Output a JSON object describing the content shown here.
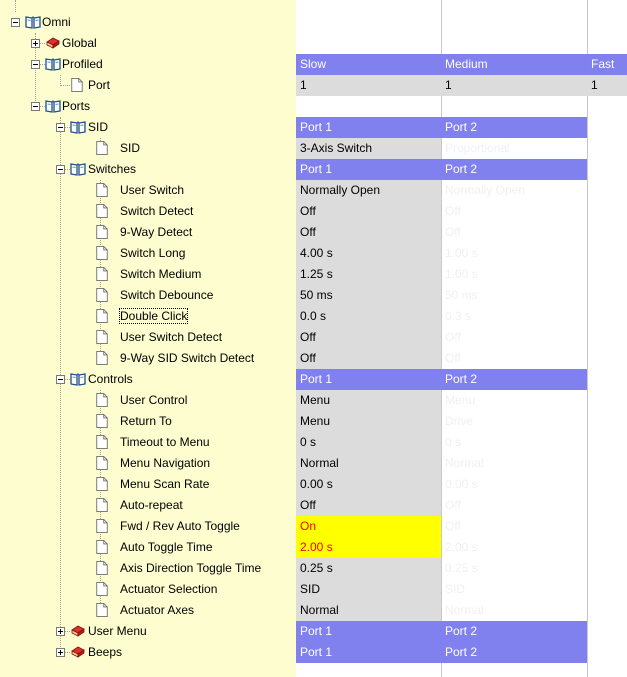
{
  "tree": [
    {
      "label": "Omni",
      "depth": 0,
      "icon": "open-book",
      "toggle": "minus"
    },
    {
      "label": "Global",
      "depth": 1,
      "icon": "closed-book",
      "toggle": "plus"
    },
    {
      "label": "Profiled",
      "depth": 1,
      "icon": "open-book",
      "toggle": "minus"
    },
    {
      "label": "Port",
      "depth": 2,
      "icon": "page"
    },
    {
      "label": "Ports",
      "depth": 1,
      "icon": "open-book",
      "toggle": "minus"
    },
    {
      "label": "SID",
      "depth": 2,
      "icon": "open-book",
      "toggle": "minus"
    },
    {
      "label": "SID",
      "depth": 3,
      "icon": "page"
    },
    {
      "label": "Switches",
      "depth": 2,
      "icon": "open-book",
      "toggle": "minus"
    },
    {
      "label": "User Switch",
      "depth": 3,
      "icon": "page"
    },
    {
      "label": "Switch Detect",
      "depth": 3,
      "icon": "page"
    },
    {
      "label": "9-Way Detect",
      "depth": 3,
      "icon": "page"
    },
    {
      "label": "Switch Long",
      "depth": 3,
      "icon": "page"
    },
    {
      "label": "Switch Medium",
      "depth": 3,
      "icon": "page"
    },
    {
      "label": "Switch Debounce",
      "depth": 3,
      "icon": "page"
    },
    {
      "label": "Double Click",
      "depth": 3,
      "icon": "page",
      "focus": true
    },
    {
      "label": "User Switch Detect",
      "depth": 3,
      "icon": "page"
    },
    {
      "label": "9-Way SID Switch Detect",
      "depth": 3,
      "icon": "page"
    },
    {
      "label": "Controls",
      "depth": 2,
      "icon": "open-book",
      "toggle": "minus"
    },
    {
      "label": "User Control",
      "depth": 3,
      "icon": "page"
    },
    {
      "label": "Return To",
      "depth": 3,
      "icon": "page"
    },
    {
      "label": "Timeout to Menu",
      "depth": 3,
      "icon": "page"
    },
    {
      "label": "Menu Navigation",
      "depth": 3,
      "icon": "page"
    },
    {
      "label": "Menu Scan Rate",
      "depth": 3,
      "icon": "page"
    },
    {
      "label": "Auto-repeat",
      "depth": 3,
      "icon": "page"
    },
    {
      "label": "Fwd / Rev Auto Toggle",
      "depth": 3,
      "icon": "page"
    },
    {
      "label": "Auto Toggle Time",
      "depth": 3,
      "icon": "page"
    },
    {
      "label": "Axis Direction Toggle Time",
      "depth": 3,
      "icon": "page"
    },
    {
      "label": "Actuator Selection",
      "depth": 3,
      "icon": "page"
    },
    {
      "label": "Actuator Axes",
      "depth": 3,
      "icon": "page"
    },
    {
      "label": "User Menu",
      "depth": 2,
      "icon": "closed-book",
      "toggle": "plus"
    },
    {
      "label": "Beeps",
      "depth": 2,
      "icon": "closed-book",
      "toggle": "plus"
    }
  ],
  "grid": [
    [],
    [],
    [
      {
        "v": "Slow",
        "s": "hdr"
      },
      {
        "v": "Medium",
        "s": "hdr"
      },
      {
        "v": "Fast",
        "s": "hdr"
      }
    ],
    [
      {
        "v": "1",
        "s": "gray"
      },
      {
        "v": "1",
        "s": "gray"
      },
      {
        "v": "1",
        "s": "gray"
      }
    ],
    [],
    [
      {
        "v": "Port 1",
        "s": "hdr"
      },
      {
        "v": "Port 2",
        "s": "hdr"
      }
    ],
    [
      {
        "v": "3-Axis Switch",
        "s": "gray"
      },
      {
        "v": "Proportional",
        "s": "dim"
      }
    ],
    [
      {
        "v": "Port 1",
        "s": "hdr"
      },
      {
        "v": "Port 2",
        "s": "hdr"
      }
    ],
    [
      {
        "v": "Normally Open",
        "s": "gray"
      },
      {
        "v": "Normally Open",
        "s": "dim"
      }
    ],
    [
      {
        "v": "Off",
        "s": "gray"
      },
      {
        "v": "Off",
        "s": "dim"
      }
    ],
    [
      {
        "v": "Off",
        "s": "gray"
      },
      {
        "v": "Off",
        "s": "dim"
      }
    ],
    [
      {
        "v": "4.00 s",
        "s": "gray"
      },
      {
        "v": "1.00 s",
        "s": "dim"
      }
    ],
    [
      {
        "v": "1.25 s",
        "s": "gray"
      },
      {
        "v": "1.00 s",
        "s": "dim"
      }
    ],
    [
      {
        "v": "50 ms",
        "s": "gray"
      },
      {
        "v": "50 ms",
        "s": "dim"
      }
    ],
    [
      {
        "v": "0.0 s",
        "s": "gray"
      },
      {
        "v": "0.3 s",
        "s": "dim"
      }
    ],
    [
      {
        "v": "Off",
        "s": "gray"
      },
      {
        "v": "Off",
        "s": "dim"
      }
    ],
    [
      {
        "v": "Off",
        "s": "gray"
      },
      {
        "v": "Off",
        "s": "dim"
      }
    ],
    [
      {
        "v": "Port 1",
        "s": "hdr"
      },
      {
        "v": "Port 2",
        "s": "hdr"
      }
    ],
    [
      {
        "v": "Menu",
        "s": "gray"
      },
      {
        "v": "Menu",
        "s": "dim"
      }
    ],
    [
      {
        "v": "Menu",
        "s": "gray"
      },
      {
        "v": "Drive",
        "s": "dim"
      }
    ],
    [
      {
        "v": "0 s",
        "s": "gray"
      },
      {
        "v": "0 s",
        "s": "dim"
      }
    ],
    [
      {
        "v": "Normal",
        "s": "gray"
      },
      {
        "v": "Normal",
        "s": "dim"
      }
    ],
    [
      {
        "v": "0.00 s",
        "s": "gray"
      },
      {
        "v": "0.00 s",
        "s": "dim"
      }
    ],
    [
      {
        "v": "Off",
        "s": "gray"
      },
      {
        "v": "Off",
        "s": "dim"
      }
    ],
    [
      {
        "v": "On",
        "s": "yellow"
      },
      {
        "v": "Off",
        "s": "dim"
      }
    ],
    [
      {
        "v": "2.00 s",
        "s": "yellow"
      },
      {
        "v": "2.00 s",
        "s": "dim"
      }
    ],
    [
      {
        "v": "0.25 s",
        "s": "gray"
      },
      {
        "v": "0.25 s",
        "s": "dim"
      }
    ],
    [
      {
        "v": "SID",
        "s": "gray"
      },
      {
        "v": "SID",
        "s": "dim"
      }
    ],
    [
      {
        "v": "Normal",
        "s": "gray"
      },
      {
        "v": "Normal",
        "s": "dim"
      }
    ],
    [
      {
        "v": "Port 1",
        "s": "hdr"
      },
      {
        "v": "Port 2",
        "s": "hdr"
      }
    ],
    [
      {
        "v": "Port 1",
        "s": "hdr"
      },
      {
        "v": "Port 2",
        "s": "hdr"
      }
    ]
  ],
  "colors": {
    "tree_bg": "#fdfdd0",
    "header_bg": "#8080ef",
    "value_bg": "#dcdcdc",
    "highlight_bg": "#ffff00",
    "highlight_text": "#ff0000",
    "dim_text": "#f0f0f0"
  }
}
